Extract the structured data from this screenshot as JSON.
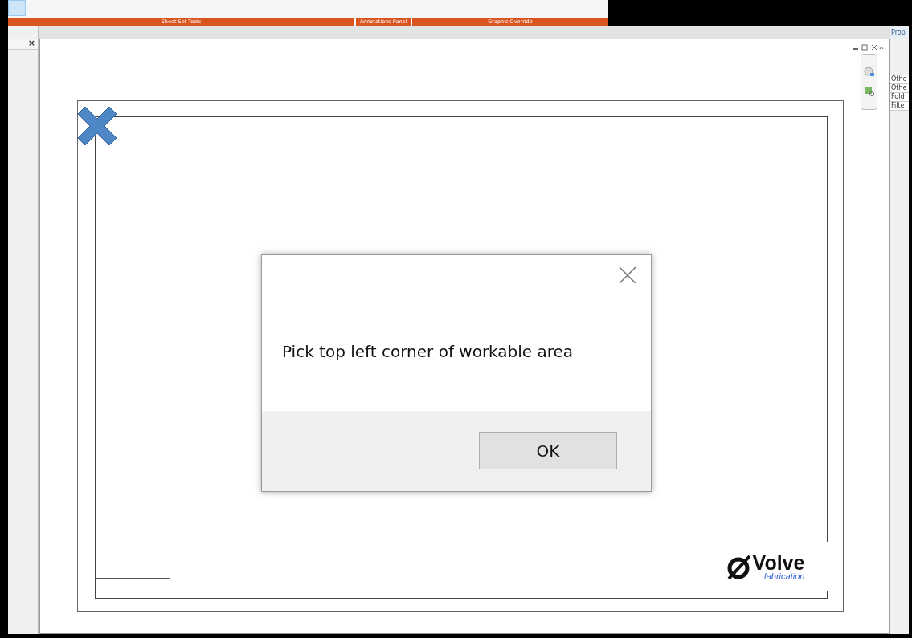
{
  "ribbon": {
    "panels": [
      {
        "label": "Sheet Set Tools"
      },
      {
        "label": "Annotations Panel"
      },
      {
        "label": "Graphic Override"
      }
    ]
  },
  "left_panel": {
    "close": "×"
  },
  "properties": {
    "title": "Prop",
    "rows": [
      "Othe",
      "Othe",
      "Fold",
      "Filte"
    ]
  },
  "dialog": {
    "message": "Pick top left corner of workable area",
    "button": "OK"
  },
  "logo": {
    "name": "Volve",
    "subtitle": "fabrication"
  }
}
